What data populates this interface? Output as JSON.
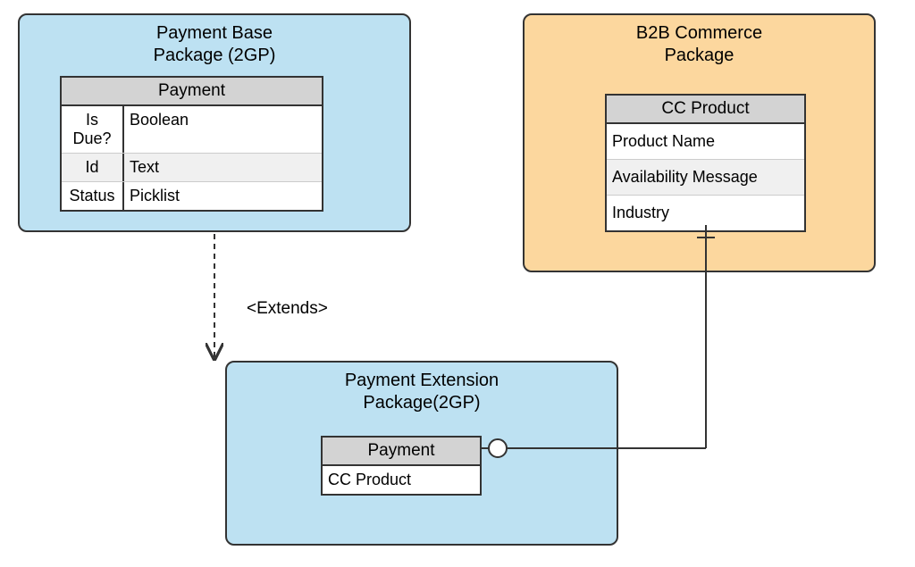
{
  "packages": {
    "base": {
      "title_l1": "Payment Base",
      "title_l2": "Package (2GP)"
    },
    "b2b": {
      "title_l1": "B2B Commerce",
      "title_l2": "Package"
    },
    "ext": {
      "title_l1": "Payment Extension",
      "title_l2": "Package(2GP)"
    }
  },
  "tables": {
    "payment_base": {
      "header": "Payment",
      "rows": [
        {
          "a": "Is Due?",
          "b": "Boolean"
        },
        {
          "a": "Id",
          "b": "Text"
        },
        {
          "a": "Status",
          "b": "Picklist"
        }
      ]
    },
    "cc_product": {
      "header": "CC Product",
      "rows": [
        {
          "a": "Product Name"
        },
        {
          "a": "Availability Message"
        },
        {
          "a": "Industry"
        }
      ]
    },
    "payment_ext": {
      "header": "Payment",
      "rows": [
        {
          "a": "CC Product"
        }
      ]
    }
  },
  "connectors": {
    "extends_label": "<Extends>"
  }
}
